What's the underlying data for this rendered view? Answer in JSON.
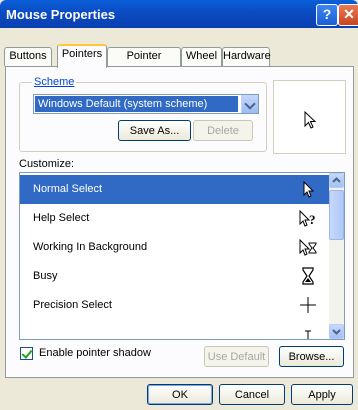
{
  "window": {
    "title": "Mouse Properties",
    "help_glyph": "?",
    "close_glyph": "✕"
  },
  "tabs": [
    {
      "label": "Buttons"
    },
    {
      "label": "Pointers"
    },
    {
      "label": "Pointer Options"
    },
    {
      "label": "Wheel"
    },
    {
      "label": "Hardware"
    }
  ],
  "scheme": {
    "group_label": "Scheme",
    "selected": "Windows Default (system scheme)",
    "save_as": "Save As...",
    "delete": "Delete"
  },
  "customize": {
    "label": "Customize:",
    "items": [
      {
        "label": "Normal Select",
        "icon": "arrow-cursor-icon",
        "selected": true
      },
      {
        "label": "Help Select",
        "icon": "help-cursor-icon"
      },
      {
        "label": "Working In Background",
        "icon": "working-cursor-icon"
      },
      {
        "label": "Busy",
        "icon": "hourglass-cursor-icon"
      },
      {
        "label": "Precision Select",
        "icon": "crosshair-cursor-icon"
      },
      {
        "label": "",
        "icon": "text-cursor-icon"
      }
    ]
  },
  "options": {
    "pointer_shadow": "Enable pointer shadow",
    "pointer_shadow_checked": true
  },
  "buttons": {
    "use_default": "Use Default",
    "browse": "Browse...",
    "ok": "OK",
    "cancel": "Cancel",
    "apply": "Apply"
  }
}
